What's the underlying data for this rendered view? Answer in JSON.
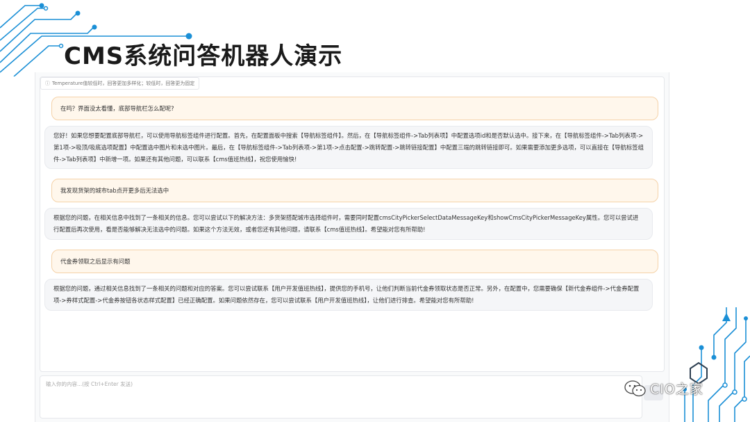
{
  "title": "CMS系统问答机器人演示",
  "temperature_hint": "Temperature值较低时，回答更加多样化；较低时，回答更为固定",
  "messages": [
    {
      "role": "user",
      "text": "在吗？界面没太看懂，底部导航栏怎么配呢?"
    },
    {
      "role": "bot",
      "text": "您好！如果您想要配置底部导航栏，可以使用导航标签组件进行配置。首先，在配置面板中搜索【导航标签组件】。然后，在【导航标签组件->Tab列表项】中配置选项id和是否默认选中。接下来，在【导航标签组件->Tab列表项->第1项->吸顶/吸底选项配置】中配置选中图片和未选中图片。最后，在【导航标签组件->Tab列表项->第1项->点击配置->跳转配置->跳转链接配置】中配置三端的跳转链接即可。如果需要添加更多选项，可以直接在【导航标签组件->Tab列表项】中新增一项。如果还有其他问题，可以联系【cms值班热线】，祝您使用愉快!"
    },
    {
      "role": "user",
      "text": "我发现货架的城市tab点开更多后无法选中"
    },
    {
      "role": "bot",
      "text": "根据您的问题，在相关信息中找到了一条相关的信息。您可以尝试以下的解决方法：多货架搭配城市选择组件时，需要同时配置cmsCityPickerSelectDataMessageKey和showCmsCityPickerMessageKey属性。您可以尝试进行配置后再次使用，看是否能够解决无法选中的问题。如果这个方法无效，或者您还有其他问题，请联系【cms值班热线】。希望能对您有所帮助!"
    },
    {
      "role": "user",
      "text": "代金券领取之后显示有问题"
    },
    {
      "role": "bot",
      "text": "根据您的问题，通过相关信息找到了一条相关的问题和对应的答案。您可以尝试联系【用户开发值班热线】，提供您的手机号，让他们判断当前代金券领取状态是否正常。另外，在配置中，您需要确保【新代金券组件->代金券配置项->券样式配置->代金券按钮各状态样式配置】已经正确配置。如果问题依然存在，您可以尝试联系【用户开发值班热线】，让他们进行排查。希望能对您有所帮助!"
    }
  ],
  "input": {
    "placeholder": "输入你的内容...(按 Ctrl+Enter 发送)",
    "value": ""
  },
  "watermark": {
    "text": "CIO之家"
  },
  "colors": {
    "accent": "#1a8fd6",
    "user_bubble_bg": "#fff7ec",
    "user_bubble_border": "#f5d2a8",
    "bot_bubble_bg": "#f5f6f8"
  },
  "icons": {
    "hint": "info-icon",
    "watermark_logo": "wechat-logo-icon",
    "send": "send-icon"
  }
}
